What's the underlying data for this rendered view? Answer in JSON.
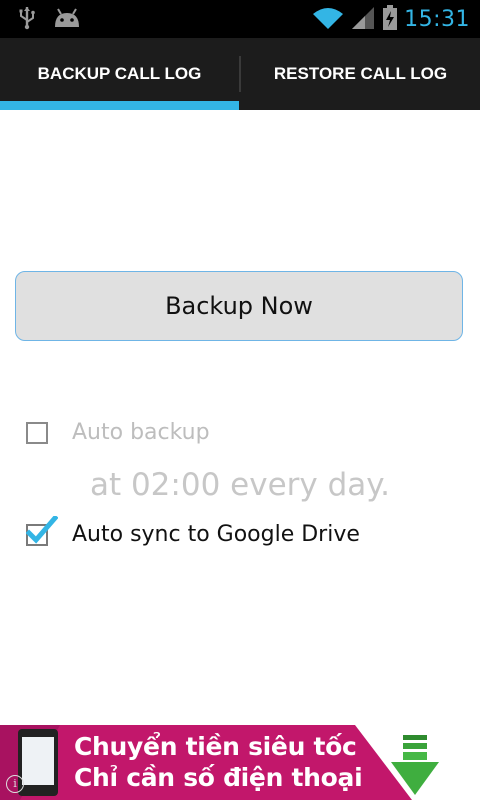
{
  "status_bar": {
    "time": "15:31",
    "icons": [
      "usb-icon",
      "android-icon",
      "wifi-icon",
      "signal-icon",
      "battery-charging-icon"
    ]
  },
  "tabs": [
    {
      "label": "BACKUP CALL LOG",
      "selected": true
    },
    {
      "label": "RESTORE CALL LOG",
      "selected": false
    }
  ],
  "colors": {
    "accent": "#33b5e5",
    "tab_bar": "#1c1c1c",
    "ad_background": "#c2176b"
  },
  "main": {
    "backup_button_label": "Backup Now",
    "auto_backup": {
      "label": "Auto backup",
      "checked": false,
      "enabled": false
    },
    "schedule_text": "at 02:00 every day.",
    "auto_sync": {
      "label": "Auto sync to Google Drive",
      "checked": true
    }
  },
  "ad": {
    "line1": "Chuyển tiền siêu tốc",
    "line2": "Chỉ cần số điện thoại",
    "info_icon": "info-icon",
    "download_icon": "download-arrow-icon"
  }
}
